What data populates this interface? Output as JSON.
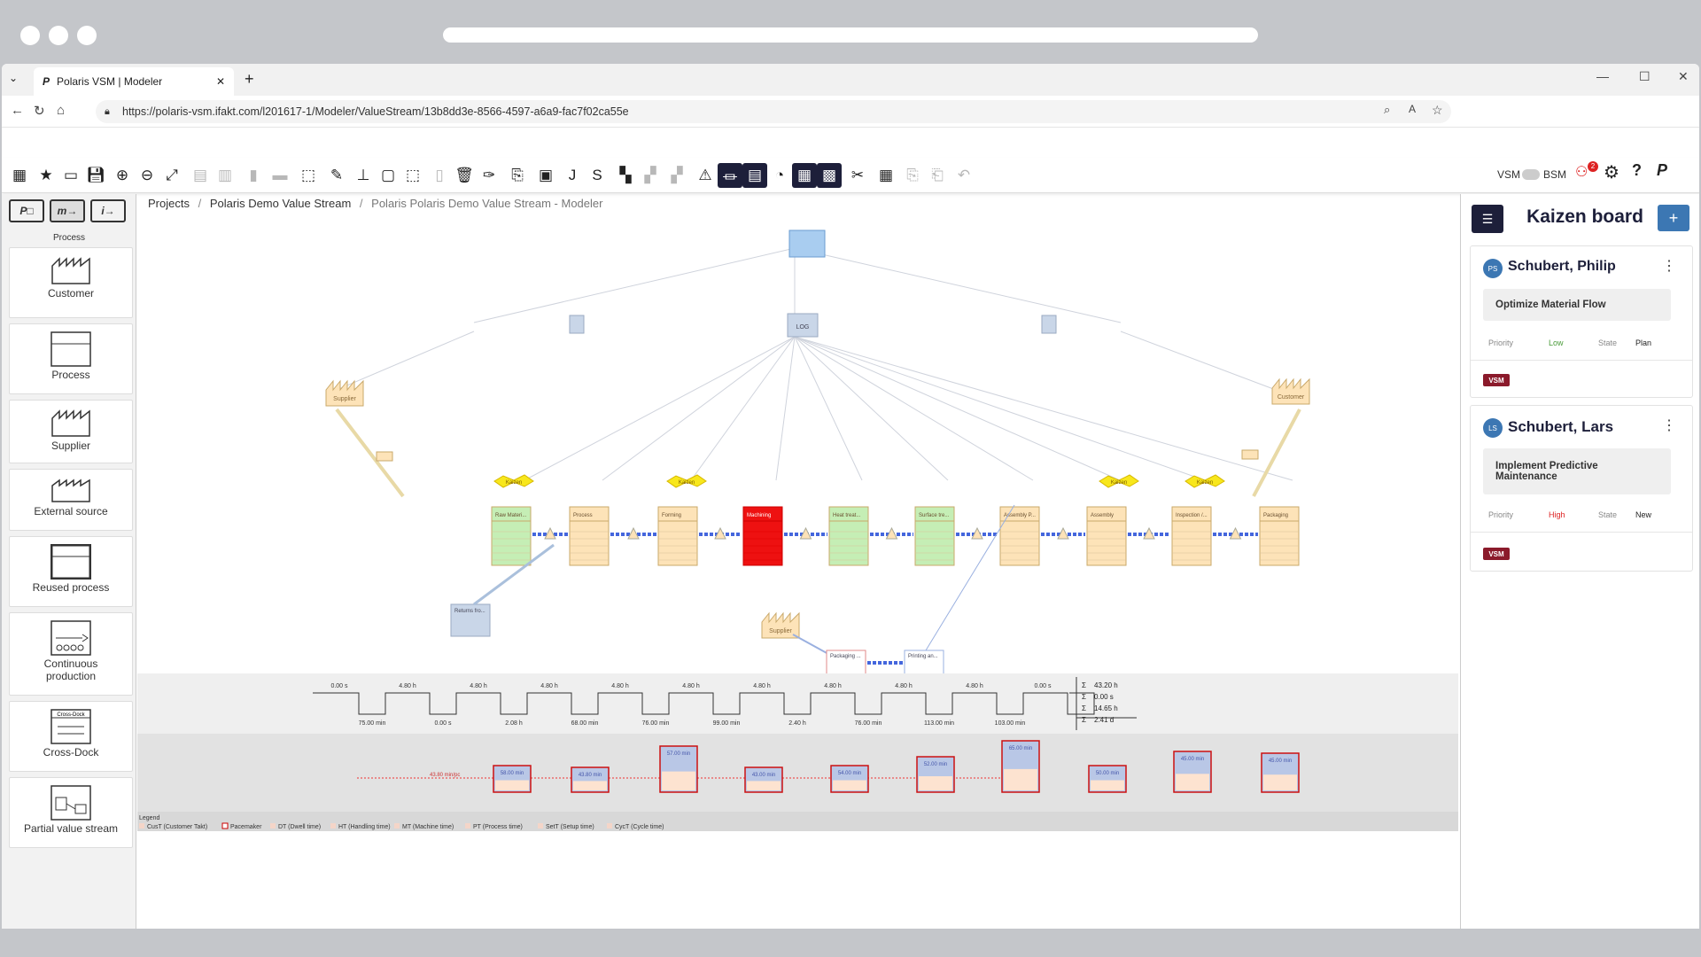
{
  "browser": {
    "tab_title": "Polaris VSM | Modeler",
    "url": "https://polaris-vsm.ifakt.com/l201617-1/Modeler/ValueStream/13b8dd3e-8566-4597-a6a9-fac7f02ca55e"
  },
  "toolbar": {
    "toggle_left": "VSM",
    "toggle_right": "BSM",
    "icons": [
      "apps-icon",
      "star-icon",
      "ruler-icon",
      "save-icon",
      "zoom-in-icon",
      "zoom-out-icon",
      "fit-icon",
      "align-icon",
      "distribute-icon",
      "stack-icon",
      "link-icon",
      "select-icon",
      "pencil-icon",
      "stamp-icon",
      "frame-icon",
      "lasso-icon",
      "box-icon",
      "trash-icon",
      "paint-icon",
      "export-icon",
      "image-icon",
      "jpg-icon",
      "svg-icon",
      "layers-icon",
      "group-icon",
      "ungroup-icon",
      "triangle-icon",
      "timeline-icon",
      "table-icon",
      "cycle-icon",
      "zoom-area-icon",
      "report-icon",
      "tools-icon",
      "calculator-icon",
      "copy-icon",
      "paste-icon",
      "undo-icon"
    ],
    "alert_count": "2"
  },
  "left_panel": {
    "tabs": [
      "P",
      "m",
      "i"
    ],
    "active_label": "Process",
    "items": [
      "Customer",
      "Process",
      "Supplier",
      "External source",
      "Reused process",
      "Continuous production",
      "Cross-Dock",
      "Partial value stream"
    ],
    "crossdock_mini": "Cross-Dock"
  },
  "breadcrumb": {
    "projects": "Projects",
    "stream": "Polaris Demo Value Stream",
    "current": "Polaris Polaris Demo Value Stream - Modeler"
  },
  "diagram": {
    "top_labels": [
      "LOG"
    ],
    "suppliers": [
      "Supplier",
      "Customer"
    ],
    "kaizen_label": "Kaizen",
    "processes": [
      "Raw Materi...",
      "Process",
      "Forming",
      "Machining",
      "Heat treat...",
      "Surface tre...",
      "Assembly P...",
      "Assembly",
      "Inspection /...",
      "Packaging"
    ],
    "external": "Returns fro...",
    "sub_supplier": "Supplier",
    "sub_processes": [
      "Packaging ...",
      "Printing an..."
    ],
    "timeline_top": [
      "0.00 s",
      "4.80 h",
      "4.80 h",
      "4.80 h",
      "4.80 h",
      "4.80 h",
      "4.80 h",
      "4.80 h",
      "4.80 h",
      "4.80 h",
      "0.00 s"
    ],
    "timeline_bottom": [
      "75.00 min",
      "0.00 s",
      "2.08 h",
      "68.00 min",
      "76.00 min",
      "99.00 min",
      "2.40 h",
      "76.00 min",
      "113.00 min",
      "103.00 min"
    ],
    "sums": [
      "43.20 h",
      "0.00 s",
      "14.65 h",
      "2.41 d"
    ],
    "sigma": "Σ",
    "takt_label": "43.80 min/pc",
    "chart_boxes": [
      "58.00 min",
      "43.80 min",
      "57.00 min",
      "43.00 min",
      "54.00 min",
      "52.00 min",
      "65.00 min",
      "50.00 min",
      "45.00 min",
      "45.00 min"
    ]
  },
  "legend": {
    "title": "Legend",
    "items": [
      "CusT (Customer Takt)",
      "Pacemaker",
      "DT (Dwell time)",
      "HT (Handling time)",
      "MT (Machine time)",
      "PT (Process time)",
      "SetT (Setup time)",
      "CycT (Cycle time)"
    ]
  },
  "kaizen": {
    "title": "Kaizen board",
    "cards": [
      {
        "initials": "PS",
        "name": "Schubert, Philip",
        "task": "Optimize Material Flow",
        "priority_label": "Priority",
        "priority": "Low",
        "state_label": "State",
        "state": "Plan",
        "tag": "VSM"
      },
      {
        "initials": "LS",
        "name": "Schubert, Lars",
        "task": "Implement Predictive Maintenance",
        "priority_label": "Priority",
        "priority": "High",
        "state_label": "State",
        "state": "New",
        "tag": "VSM"
      }
    ]
  },
  "colors": {
    "dark": "#1d1f3a",
    "accent": "#3c77b3",
    "pacemaker": "#ee1111",
    "green": "#c5eeb5",
    "orange": "#fde3b8",
    "kaizen": "#f8e71c",
    "tag": "#8b1a2b"
  }
}
